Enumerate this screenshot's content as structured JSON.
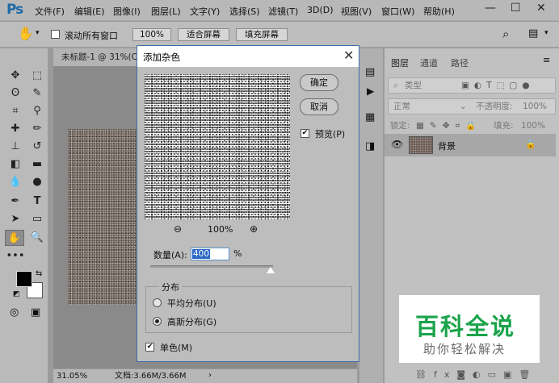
{
  "app": {
    "logo": "Ps"
  },
  "menu": [
    "文件(F)",
    "编辑(E)",
    "图像(I)",
    "图层(L)",
    "文字(Y)",
    "选择(S)",
    "滤镜(T)",
    "3D(D)",
    "视图(V)",
    "窗口(W)",
    "帮助(H)"
  ],
  "window_controls": {
    "minimize": "—",
    "maximize": "☐",
    "close": "✕"
  },
  "options_bar": {
    "scroll_all_label": "滚动所有窗口",
    "zoom_value": "100%",
    "fit_screen_label": "适合屏幕",
    "fill_screen_label": "填充屏幕"
  },
  "document": {
    "tab_title": "未标题-1 @ 31%(C",
    "zoom_status": "31.05%",
    "doc_info": "文档:3.66M/3.66M"
  },
  "layers_panel": {
    "tabs": [
      "图层",
      "通道",
      "路径"
    ],
    "kind_filter": "类型",
    "blend_mode": "正常",
    "opacity_label": "不透明度:",
    "opacity_value": "100%",
    "lock_label": "锁定:",
    "fill_label": "填充:",
    "fill_value": "100%",
    "layer_name": "背景"
  },
  "dialog": {
    "title": "添加杂色",
    "ok_label": "确定",
    "cancel_label": "取消",
    "preview_label": "预览(P)",
    "preview_zoom": "100%",
    "amount_label": "数量(A):",
    "amount_value": "400",
    "amount_unit": "%",
    "amount_fraction": 0.98,
    "distribution_label": "分布",
    "uniform_label": "平均分布(U)",
    "gaussian_label": "高斯分布(G)",
    "mono_label": "单色(M)",
    "preview_checked": true,
    "mono_checked": true,
    "selected_distribution": "gaussian"
  },
  "watermark": {
    "title": "百科全说",
    "subtitle": "助你轻松解决"
  },
  "colors": {
    "accent": "#1e6aa8",
    "watermark_green": "#1aa34a",
    "selection": "#2b66c4"
  }
}
